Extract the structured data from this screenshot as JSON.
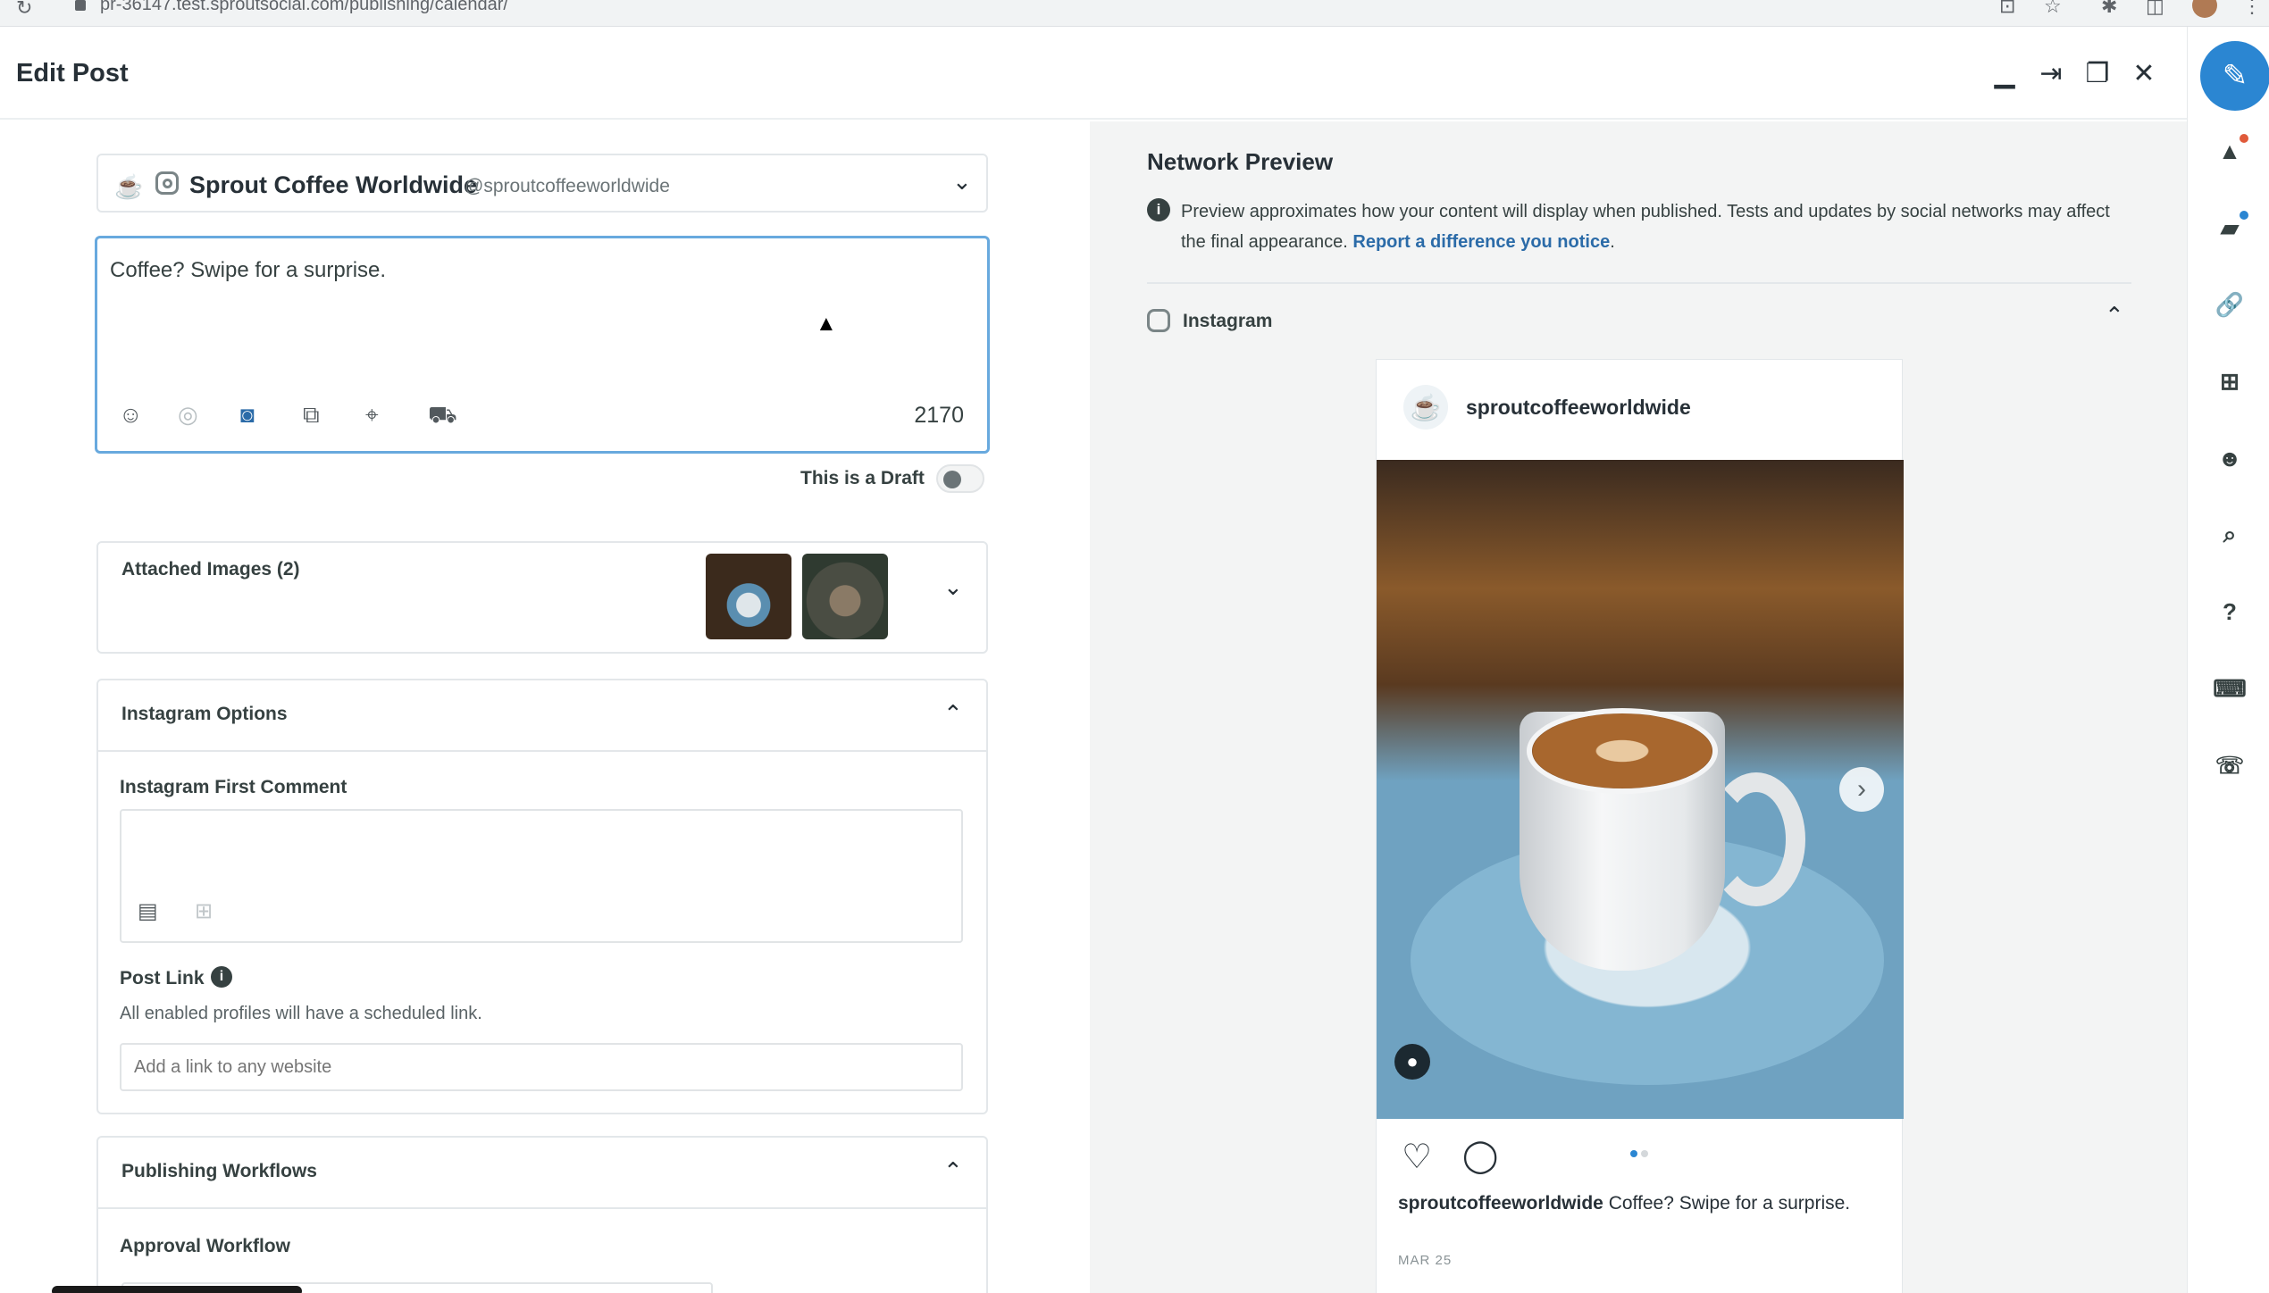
{
  "browser": {
    "url": "pr-36147.test.sproutsocial.com/publishing/calendar/"
  },
  "header": {
    "title": "Edit Post"
  },
  "profile": {
    "name": "Sprout Coffee Worldwide",
    "handle": "@sproutcoffeeworldwide"
  },
  "composer": {
    "text": "Coffee? Swipe for a surprise.",
    "char_count": "2170"
  },
  "draft": {
    "label": "This is a Draft",
    "enabled": false
  },
  "attached_images": {
    "label": "Attached Images (2)"
  },
  "instagram_options": {
    "title": "Instagram Options",
    "first_comment_label": "Instagram First Comment",
    "post_link_label": "Post Link",
    "post_link_helper": "All enabled profiles will have a scheduled link.",
    "post_link_placeholder": "Add a link to any website"
  },
  "publishing_workflows": {
    "title": "Publishing Workflows",
    "approval_label": "Approval Workflow"
  },
  "preview": {
    "title": "Network Preview",
    "info_text": "Preview approximates how your content will display when published. Tests and updates by social networks may affect the final appearance.",
    "report_link": "Report a difference you notice",
    "network_label": "Instagram",
    "username": "sproutcoffeeworldwide",
    "caption": "Coffee? Swipe for a surprise.",
    "date": "MAR 25"
  },
  "colors": {
    "accent": "#2b86d2",
    "focus_border": "#68a9de",
    "link": "#2b6ba8",
    "preview_bg": "#f3f4f4"
  }
}
